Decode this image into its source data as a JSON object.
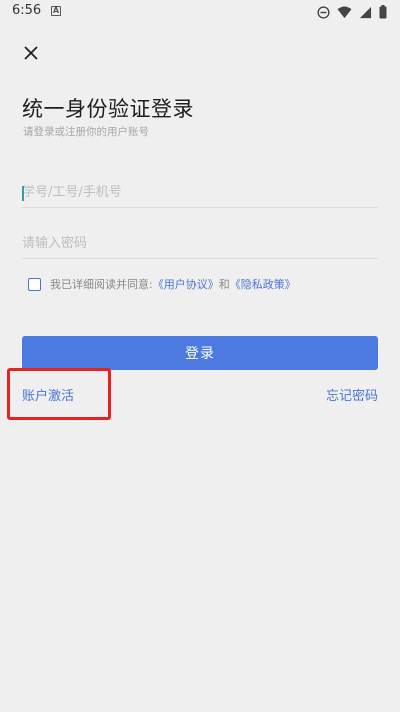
{
  "status_bar": {
    "time": "6:56",
    "notification_icon": "a-box-icon",
    "right_icons": [
      "do-not-disturb-icon",
      "wifi-icon",
      "signal-icon",
      "battery-icon"
    ]
  },
  "close_icon": "close-icon",
  "title": "统一身份验证登录",
  "subtitle": "请登录或注册你的用户账号",
  "account_input": {
    "placeholder": "学号/工号/手机号",
    "value": ""
  },
  "password_input": {
    "placeholder": "请输入密码",
    "value": ""
  },
  "agreement": {
    "prefix": "我已详细阅读并同意:",
    "user_agreement": "《用户协议》",
    "and": "和",
    "privacy_policy": "《隐私政策》",
    "checked": false
  },
  "login_button": "登录",
  "activate_account": "账户激活",
  "forgot_password": "忘记密码",
  "colors": {
    "accent": "#4d7ae0",
    "link": "#4a74d6",
    "highlight": "#e8231f",
    "background": "#efefef"
  }
}
